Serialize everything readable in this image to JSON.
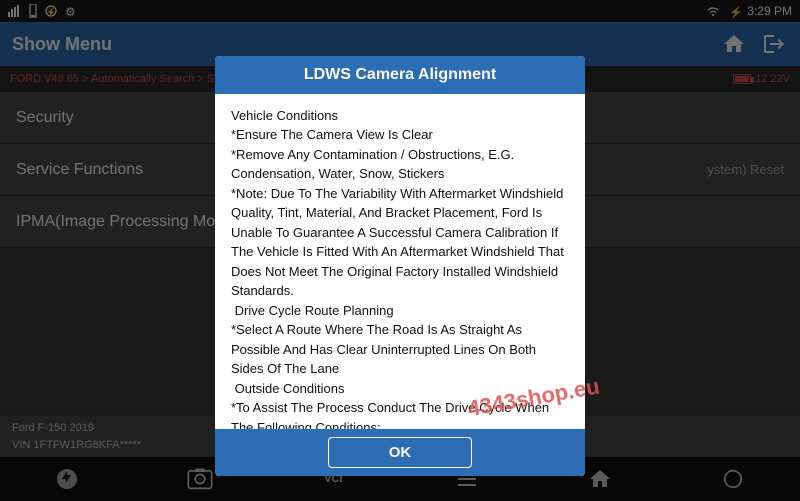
{
  "statusBar": {
    "time": "3:29 PM",
    "icons": [
      "signal",
      "wifi",
      "bluetooth",
      "battery"
    ]
  },
  "topBar": {
    "title": "Show Menu",
    "homeIcon": "🏠",
    "exitIcon": "➡"
  },
  "breadcrumb": {
    "text": "FORD V48.65 > Automatically Search > Spec",
    "voltage": "12.22V"
  },
  "menuItems": [
    {
      "label": "Security",
      "right": ""
    },
    {
      "label": "Service Functions",
      "right": "ystem) Reset"
    },
    {
      "label": "IPMA(Image Processing Module A)",
      "right": ""
    }
  ],
  "modal": {
    "title": "LDWS Camera Alignment",
    "body": "Vehicle Conditions\n*Ensure The Camera View Is Clear\n*Remove Any Contamination / Obstructions, E.G. Condensation, Water, Snow, Stickers\n*Note: Due To The Variability With Aftermarket Windshield Quality, Tint, Material, And Bracket Placement, Ford Is Unable To Guarantee A Successful Camera Calibration If The Vehicle Is Fitted With An Aftermarket Windshield That Does Not Meet The Original Factory Installed Windshield Standards.\n Drive Cycle Route Planning\n*Select A Route Where The Road Is As Straight As Possible And Has Clear Uninterrupted Lines On Both Sides Of The Lane\n Outside Conditions\n*To Assist The Process Conduct The Drive Cycle When The Following Conditions:\n*It Is A Clear And Dry Day. (No Fog, Rain, Snow Etc.)",
    "okLabel": "OK"
  },
  "watermark": "4343shop.eu",
  "footerInfo": {
    "model": "Ford F-150 2019",
    "vin": "VIN 1FTFW1RG8KFA*****"
  },
  "bottomNav": {
    "items": [
      "⚙",
      "📷",
      "VCI",
      "☰",
      "△",
      "○"
    ]
  }
}
